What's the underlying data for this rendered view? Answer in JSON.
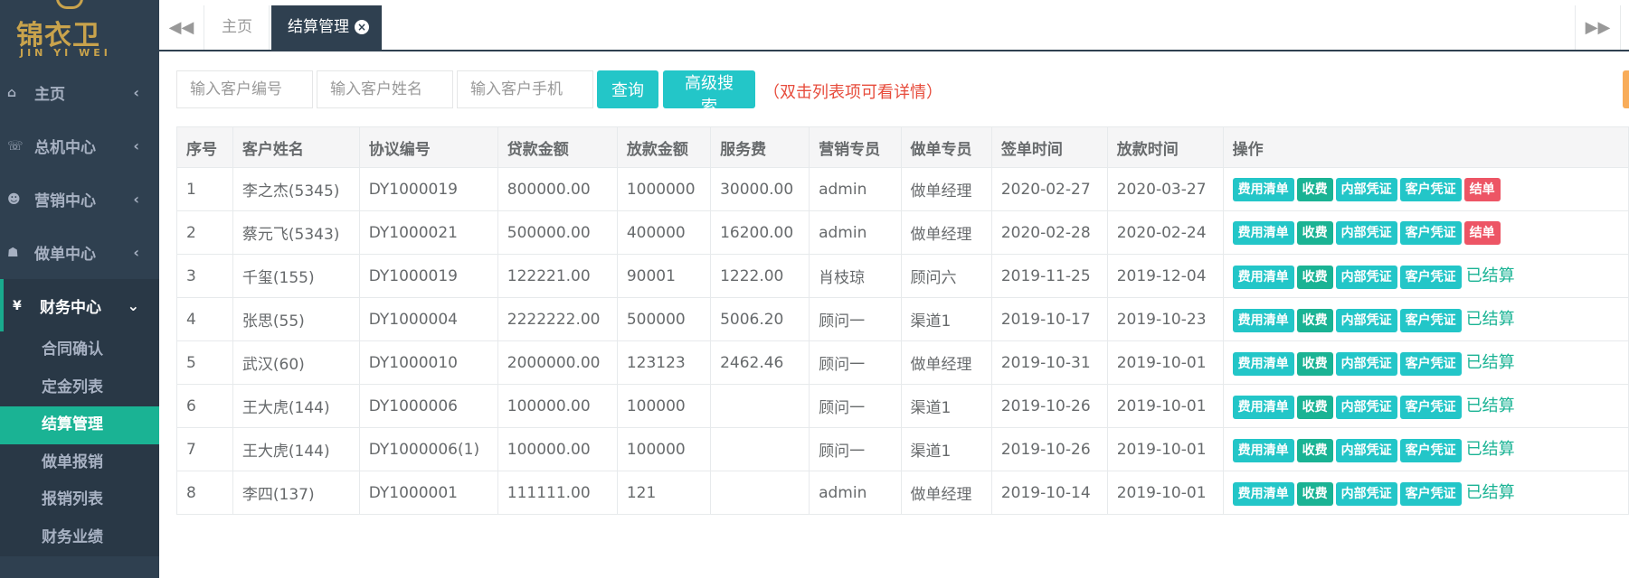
{
  "sidebar": {
    "logo_text": "锦衣卫",
    "logo_sub": "JIN YI WEI",
    "items": [
      {
        "label": "主页",
        "icon": "home-icon",
        "glyph": "⌂"
      },
      {
        "label": "总机中心",
        "icon": "phone-icon",
        "glyph": "☏"
      },
      {
        "label": "营销中心",
        "icon": "users-icon",
        "glyph": "☻"
      },
      {
        "label": "做单中心",
        "icon": "sitemap-icon",
        "glyph": "☗"
      },
      {
        "label": "财务中心",
        "icon": "yen-icon",
        "glyph": "¥"
      }
    ],
    "sub_items": [
      "合同确认",
      "定金列表",
      "结算管理",
      "做单报销",
      "报销列表",
      "财务业绩"
    ]
  },
  "tabs": {
    "home": "主页",
    "active": "结算管理"
  },
  "search": {
    "customer_no_placeholder": "输入客户编号",
    "customer_name_placeholder": "输入客户姓名",
    "customer_phone_placeholder": "输入客户手机",
    "query_label": "查询",
    "advanced_label": "高级搜索",
    "hint": "（双击列表项可看详情）"
  },
  "table": {
    "headers": [
      "序号",
      "客户姓名",
      "协议编号",
      "贷款金额",
      "放款金额",
      "服务费",
      "营销专员",
      "做单专员",
      "签单时间",
      "放款时间",
      "操作"
    ],
    "op_labels": {
      "fee_list": "费用清单",
      "charge": "收费",
      "internal_voucher": "内部凭证",
      "customer_voucher": "客户凭证",
      "settle": "结单",
      "settled": "已结算"
    },
    "rows": [
      {
        "no": "1",
        "name": "李之杰(5345)",
        "agreement": "DY1000019",
        "loan": "800000.00",
        "disbursed": "1000000",
        "fee": "30000.00",
        "sales": "admin",
        "processor": "做单经理",
        "sign_date": "2020-02-27",
        "loan_date": "2020-03-27",
        "settled": false
      },
      {
        "no": "2",
        "name": "蔡元飞(5343)",
        "agreement": "DY1000021",
        "loan": "500000.00",
        "disbursed": "400000",
        "fee": "16200.00",
        "sales": "admin",
        "processor": "做单经理",
        "sign_date": "2020-02-28",
        "loan_date": "2020-02-24",
        "settled": false
      },
      {
        "no": "3",
        "name": "千玺(155)",
        "agreement": "DY1000019",
        "loan": "122221.00",
        "disbursed": "90001",
        "fee": "1222.00",
        "sales": "肖枝琼",
        "processor": "顾问六",
        "sign_date": "2019-11-25",
        "loan_date": "2019-12-04",
        "settled": true
      },
      {
        "no": "4",
        "name": "张思(55)",
        "agreement": "DY1000004",
        "loan": "2222222.00",
        "disbursed": "500000",
        "fee": "5006.20",
        "sales": "顾问一",
        "processor": "渠道1",
        "sign_date": "2019-10-17",
        "loan_date": "2019-10-23",
        "settled": true
      },
      {
        "no": "5",
        "name": "武汉(60)",
        "agreement": "DY1000010",
        "loan": "2000000.00",
        "disbursed": "123123",
        "fee": "2462.46",
        "sales": "顾问一",
        "processor": "做单经理",
        "sign_date": "2019-10-31",
        "loan_date": "2019-10-01",
        "settled": true
      },
      {
        "no": "6",
        "name": "王大虎(144)",
        "agreement": "DY1000006",
        "loan": "100000.00",
        "disbursed": "100000",
        "fee": "",
        "sales": "顾问一",
        "processor": "渠道1",
        "sign_date": "2019-10-26",
        "loan_date": "2019-10-01",
        "settled": true
      },
      {
        "no": "7",
        "name": "王大虎(144)",
        "agreement": "DY1000006(1)",
        "loan": "100000.00",
        "disbursed": "100000",
        "fee": "",
        "sales": "顾问一",
        "processor": "渠道1",
        "sign_date": "2019-10-26",
        "loan_date": "2019-10-01",
        "settled": true
      },
      {
        "no": "8",
        "name": "李四(137)",
        "agreement": "DY1000001",
        "loan": "111111.00",
        "disbursed": "121",
        "fee": "",
        "sales": "admin",
        "processor": "做单经理",
        "sign_date": "2019-10-14",
        "loan_date": "2019-10-01",
        "settled": true
      }
    ]
  },
  "colors": {
    "sidebar_bg": "#2f4050",
    "accent": "#1ab394",
    "info": "#23c6c8",
    "danger": "#ed5565",
    "hint": "#e74c3c"
  }
}
